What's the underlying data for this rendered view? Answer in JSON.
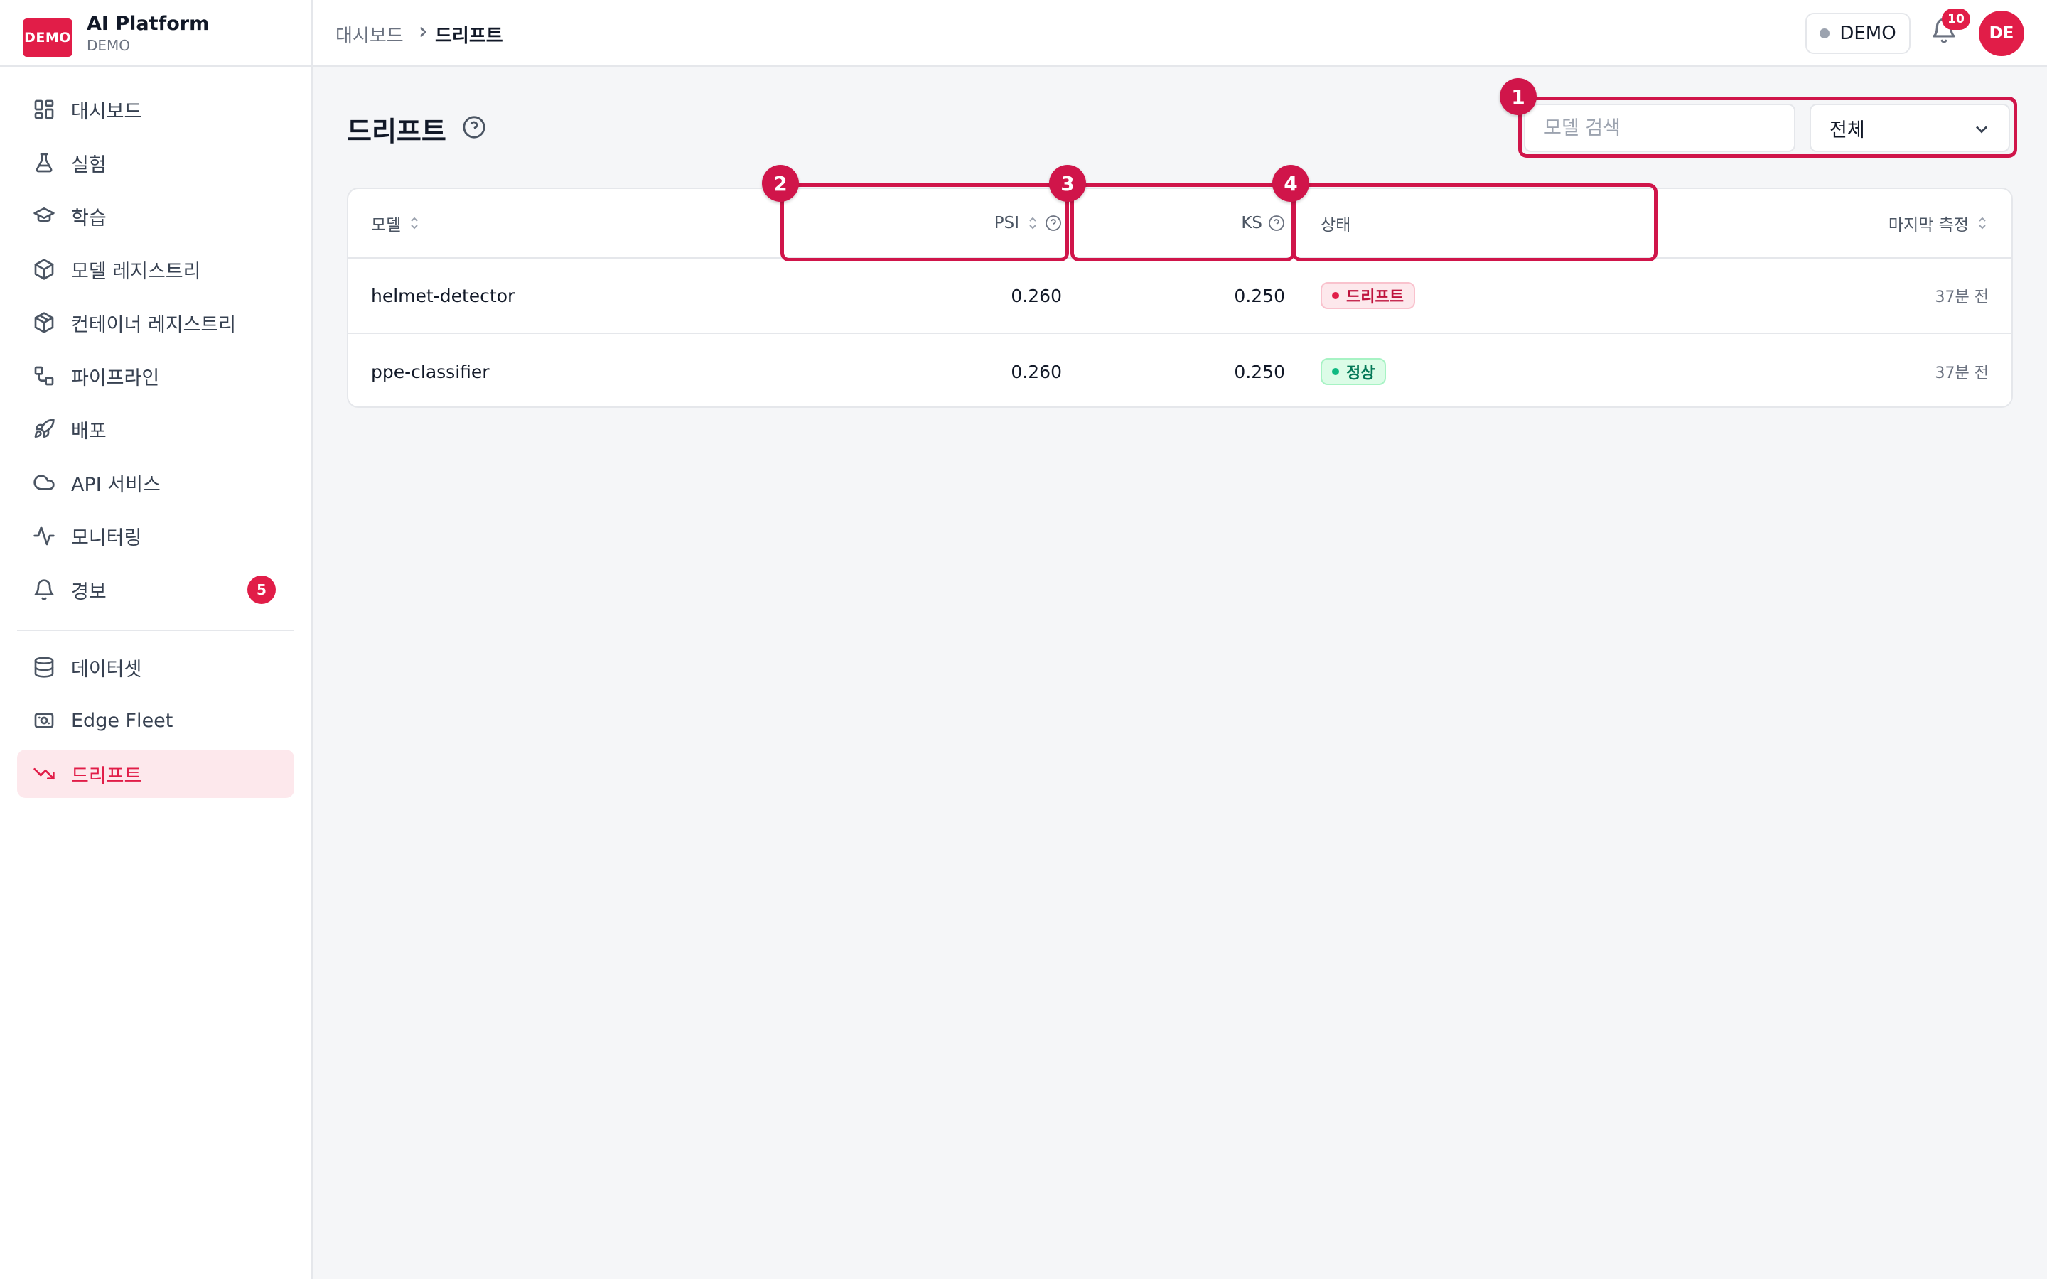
{
  "brand": {
    "logo_text": "DEMO",
    "title": "AI Platform",
    "subtitle": "DEMO"
  },
  "sidebar": {
    "items": [
      {
        "label": "대시보드",
        "icon": "dashboard-grid-icon"
      },
      {
        "label": "실험",
        "icon": "flask-icon"
      },
      {
        "label": "학습",
        "icon": "graduation-cap-icon"
      },
      {
        "label": "모델 레지스트리",
        "icon": "cube-icon"
      },
      {
        "label": "컨테이너 레지스트리",
        "icon": "package-icon"
      },
      {
        "label": "파이프라인",
        "icon": "workflow-icon"
      },
      {
        "label": "배포",
        "icon": "rocket-icon"
      },
      {
        "label": "API 서비스",
        "icon": "cloud-icon"
      },
      {
        "label": "모니터링",
        "icon": "activity-icon"
      },
      {
        "label": "경보",
        "icon": "bell-icon",
        "badge": "5"
      },
      {
        "label": "데이터셋",
        "icon": "database-icon"
      },
      {
        "label": "Edge Fleet",
        "icon": "chip-icon"
      },
      {
        "label": "드리프트",
        "icon": "trending-down-icon",
        "active": true
      }
    ]
  },
  "topbar": {
    "breadcrumb_root": "대시보드",
    "breadcrumb_current": "드리프트",
    "env_label": "DEMO",
    "notification_count": "10",
    "avatar_initials": "DE"
  },
  "page": {
    "title": "드리프트",
    "search_placeholder": "모델 검색",
    "filter_value": "전체"
  },
  "table": {
    "columns": {
      "model": "모델",
      "psi": "PSI",
      "ks": "KS",
      "status": "상태",
      "last_measured": "마지막 측정"
    },
    "rows": [
      {
        "model": "helmet-detector",
        "psi": "0.260",
        "ks": "0.250",
        "status": "드리프트",
        "last_measured": "37분 전"
      },
      {
        "model": "ppe-classifier",
        "psi": "0.260",
        "ks": "0.250",
        "status": "정상",
        "last_measured": "37분 전"
      }
    ]
  },
  "callouts": [
    "1",
    "2",
    "3",
    "4"
  ],
  "colors": {
    "accent": "#e11d48",
    "callout": "#d0154a",
    "drift": "#be123c",
    "normal": "#047857"
  }
}
